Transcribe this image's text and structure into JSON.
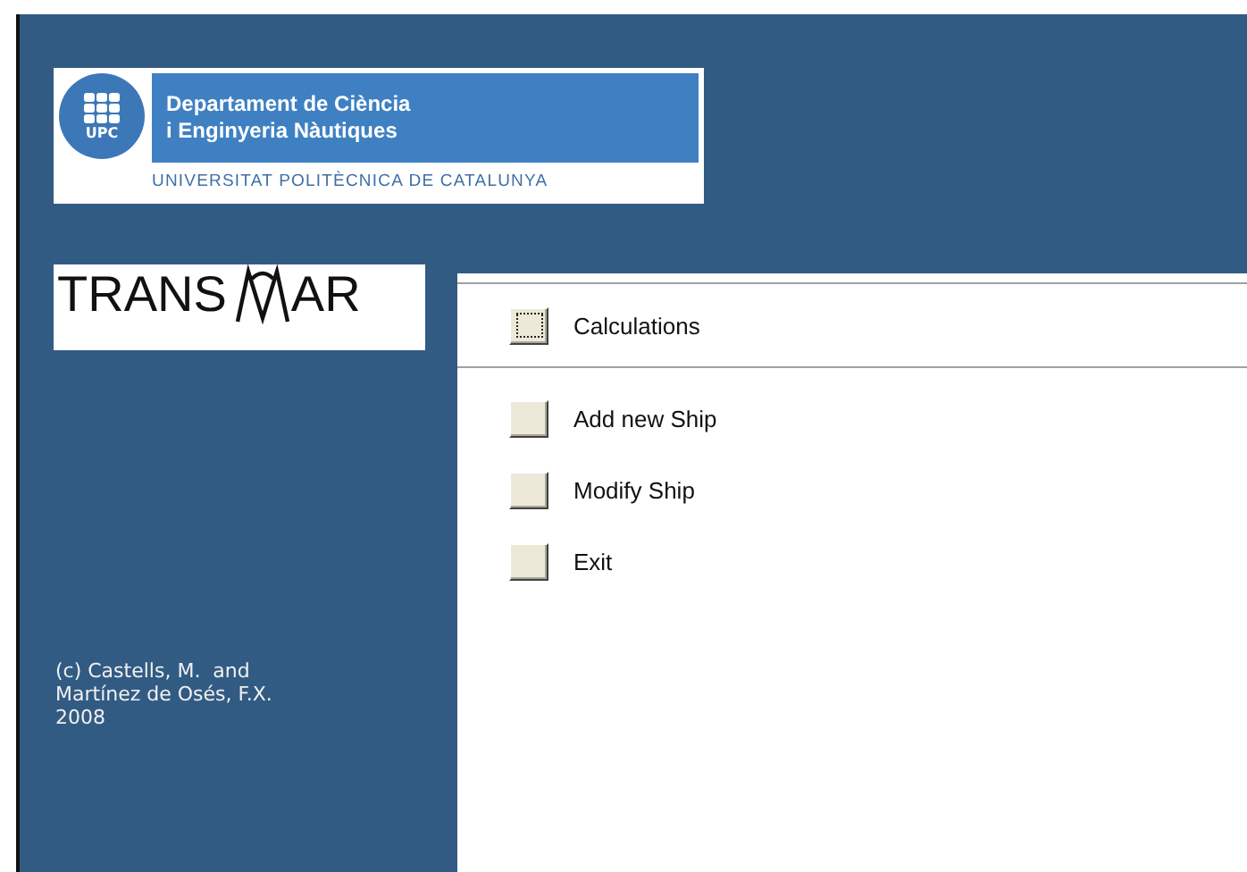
{
  "header": {
    "emblem": "UPC",
    "department": [
      "Departament de Ciència",
      "i Enginyeria Nàutiques"
    ],
    "university": "UNIVERSITAT POLITÈCNICA DE CATALUNYA"
  },
  "app_logo": {
    "before": "TRANS",
    "after": "AR"
  },
  "credits": [
    "(c) Castells, M.  and",
    "Martínez de Osés, F.X.",
    "2008"
  ],
  "top_menu": [
    {
      "label": "Calculations",
      "focused": true
    }
  ],
  "menu": [
    {
      "label": "Add new Ship",
      "focused": false
    },
    {
      "label": "Modify Ship",
      "focused": false
    },
    {
      "label": "Exit",
      "focused": false
    }
  ]
}
